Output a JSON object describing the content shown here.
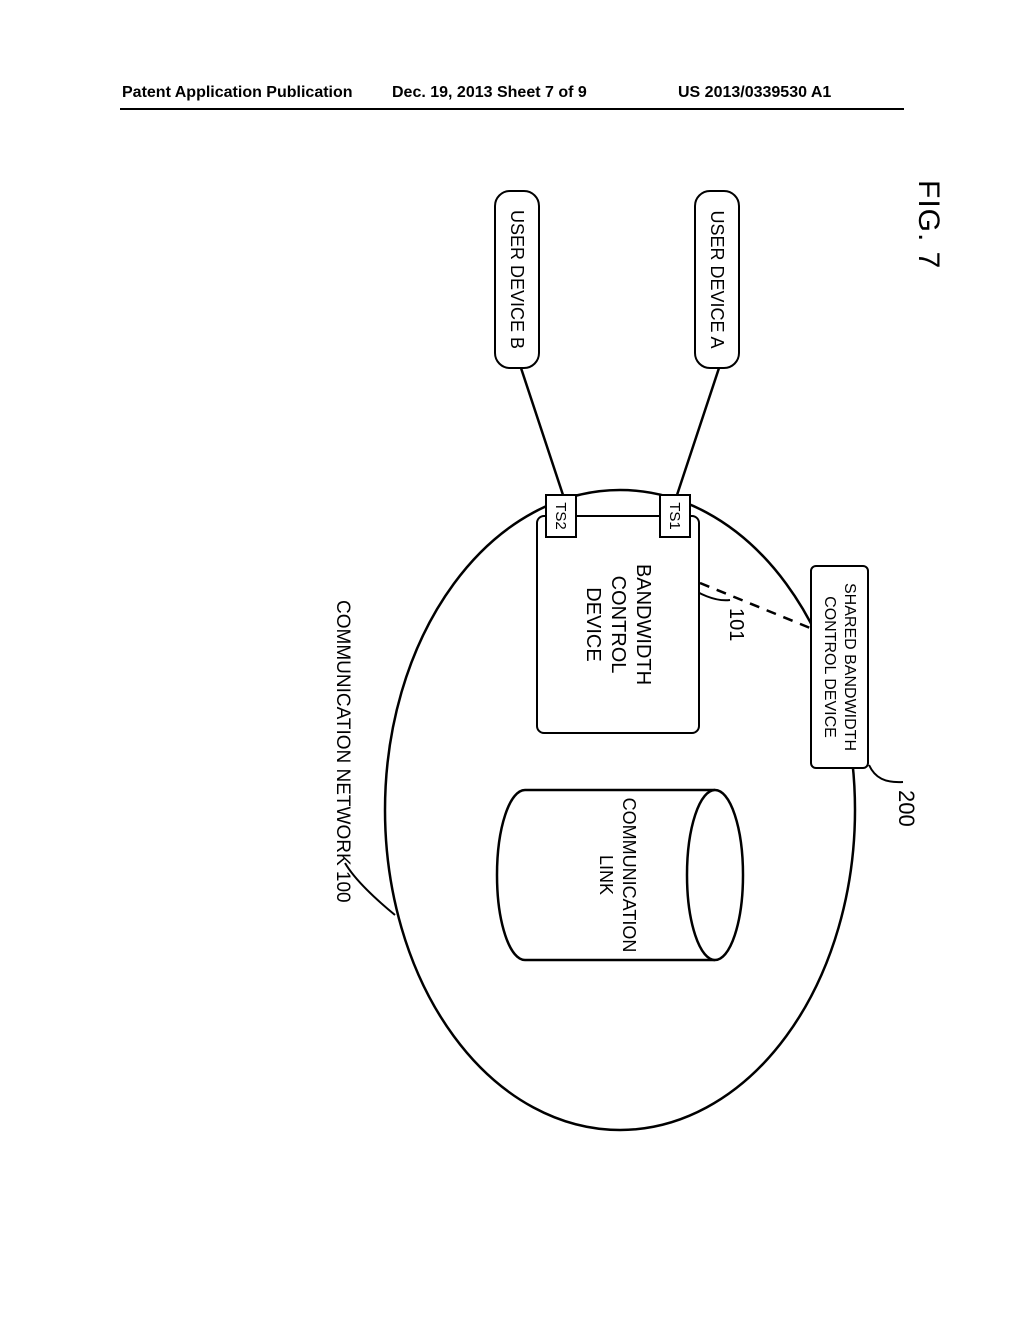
{
  "header": {
    "left": "Patent Application Publication",
    "center": "Dec. 19, 2013  Sheet 7 of 9",
    "right": "US 2013/0339530 A1"
  },
  "figure": {
    "label": "FIG. 7",
    "user_a": "USER DEVICE A",
    "user_b": "USER DEVICE B",
    "ts1": "TS1",
    "ts2": "TS2",
    "bandwidth_ctrl": "BANDWIDTH\nCONTROL\nDEVICE",
    "bandwidth_ctrl_ref": "101",
    "shared_ctrl": "SHARED BANDWIDTH\nCONTROL DEVICE",
    "shared_ctrl_ref": "200",
    "comm_link": "COMMUNICATION\nLINK",
    "network_label": "COMMUNICATION NETWORK 100"
  }
}
